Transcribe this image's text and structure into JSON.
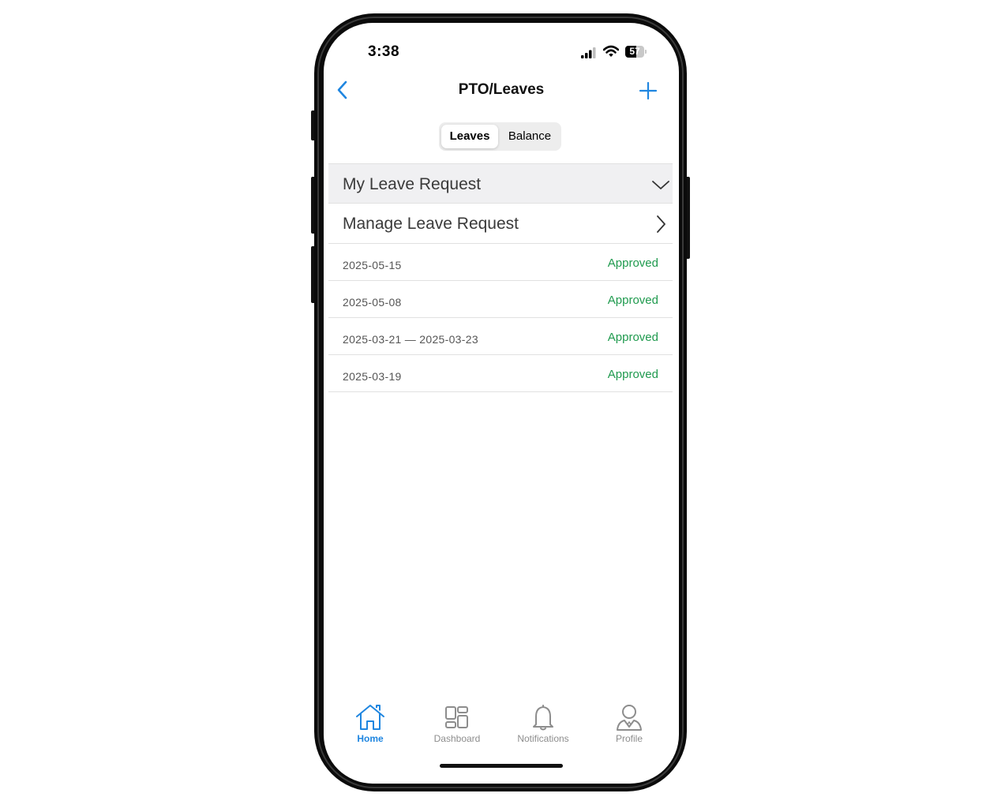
{
  "status_bar": {
    "time": "3:38",
    "battery": "57",
    "battery_level": 0.57
  },
  "nav": {
    "title": "PTO/Leaves"
  },
  "segmented": {
    "tabs": [
      {
        "label": "Leaves",
        "active": true
      },
      {
        "label": "Balance",
        "active": false
      }
    ]
  },
  "sections": {
    "my_leave_request": {
      "label": "My Leave Request",
      "expanded": true
    },
    "manage_leave_request": {
      "label": "Manage Leave Request"
    }
  },
  "leave_requests": [
    {
      "date": "2025-05-15",
      "status": "Approved"
    },
    {
      "date": "2025-05-08",
      "status": "Approved"
    },
    {
      "date": "2025-03-21 — 2025-03-23",
      "status": "Approved"
    },
    {
      "date": "2025-03-19",
      "status": "Approved"
    }
  ],
  "tab_bar": {
    "items": [
      {
        "label": "Home",
        "icon": "home-icon",
        "active": true
      },
      {
        "label": "Dashboard",
        "icon": "dashboard-icon",
        "active": false
      },
      {
        "label": "Notifications",
        "icon": "bell-icon",
        "active": false
      },
      {
        "label": "Profile",
        "icon": "profile-icon",
        "active": false
      }
    ]
  },
  "colors": {
    "accent": "#1f86e0",
    "approved": "#1f9a4e",
    "section_header_bg": "#f0f0f2"
  }
}
